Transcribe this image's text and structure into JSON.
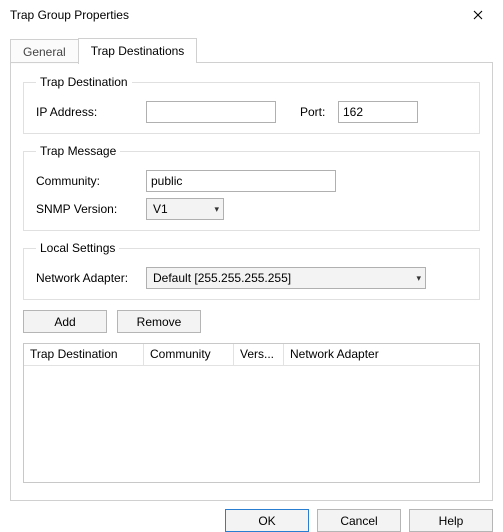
{
  "window": {
    "title": "Trap Group Properties"
  },
  "tabs": {
    "general": "General",
    "destinations": "Trap Destinations"
  },
  "groups": {
    "trapDestination": {
      "legend": "Trap Destination",
      "ipLabel": "IP Address:",
      "ipValue": "",
      "portLabel": "Port:",
      "portValue": "162"
    },
    "trapMessage": {
      "legend": "Trap Message",
      "communityLabel": "Community:",
      "communityValue": "public",
      "snmpLabel": "SNMP Version:",
      "snmpValue": "V1"
    },
    "localSettings": {
      "legend": "Local Settings",
      "adapterLabel": "Network Adapter:",
      "adapterValue": "Default [255.255.255.255]"
    }
  },
  "buttons": {
    "add": "Add",
    "remove": "Remove",
    "ok": "OK",
    "cancel": "Cancel",
    "help": "Help"
  },
  "table": {
    "columns": {
      "dest": "Trap Destination",
      "community": "Community",
      "version": "Vers...",
      "adapter": "Network Adapter"
    },
    "rows": []
  }
}
